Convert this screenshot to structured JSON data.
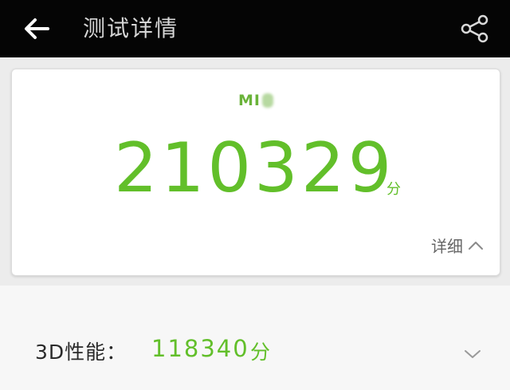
{
  "header": {
    "title": "测试详情",
    "back_icon": "arrow-left-icon",
    "share_icon": "share-icon"
  },
  "score_card": {
    "device_name": "MI",
    "total_score": "210329",
    "score_unit": "分",
    "details_label": "详细",
    "details_icon": "chevron-up-icon"
  },
  "performance": {
    "label": "3D性能：",
    "value": "118340",
    "unit": "分",
    "expand_icon": "chevron-down-icon"
  },
  "colors": {
    "topbar": "#050505",
    "score_green": "#62bf2a",
    "card_bg": "#ffffff",
    "page_bg": "#ececec"
  }
}
